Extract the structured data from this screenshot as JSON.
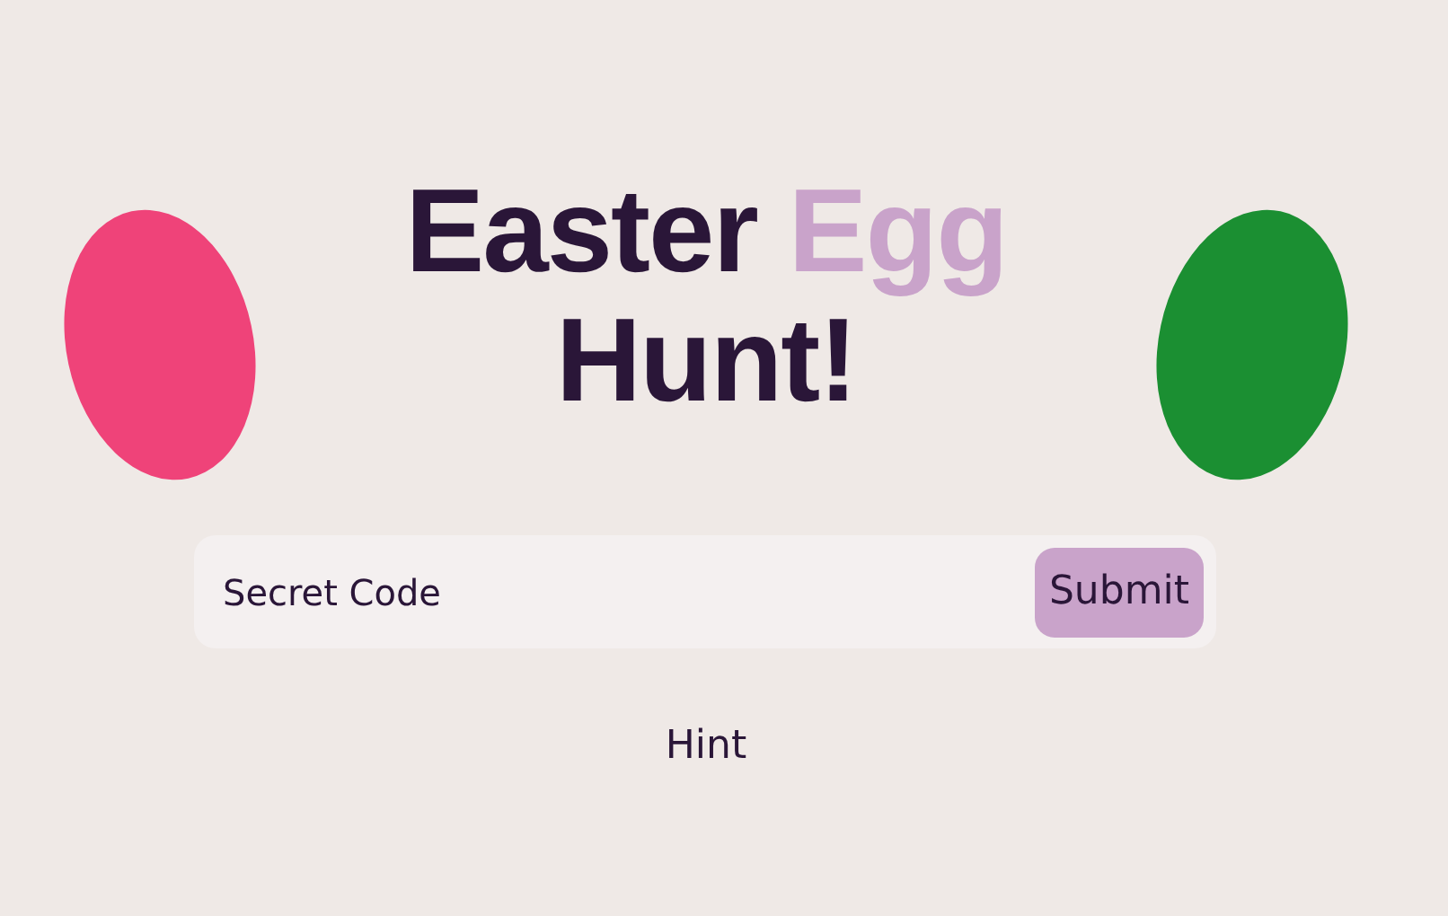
{
  "title": {
    "parts": [
      {
        "text": "Easter ",
        "accent": false
      },
      {
        "text": "Egg",
        "accent": true
      },
      {
        "text": "Hunt!",
        "accent": false
      }
    ]
  },
  "eggs": [
    {
      "color": "#ef4379"
    },
    {
      "color": "#1b8f32"
    }
  ],
  "code_field": {
    "placeholder": "Secret Code"
  },
  "submit_button": {
    "label": "Submit"
  },
  "hint_link": {
    "label": "Hint"
  }
}
